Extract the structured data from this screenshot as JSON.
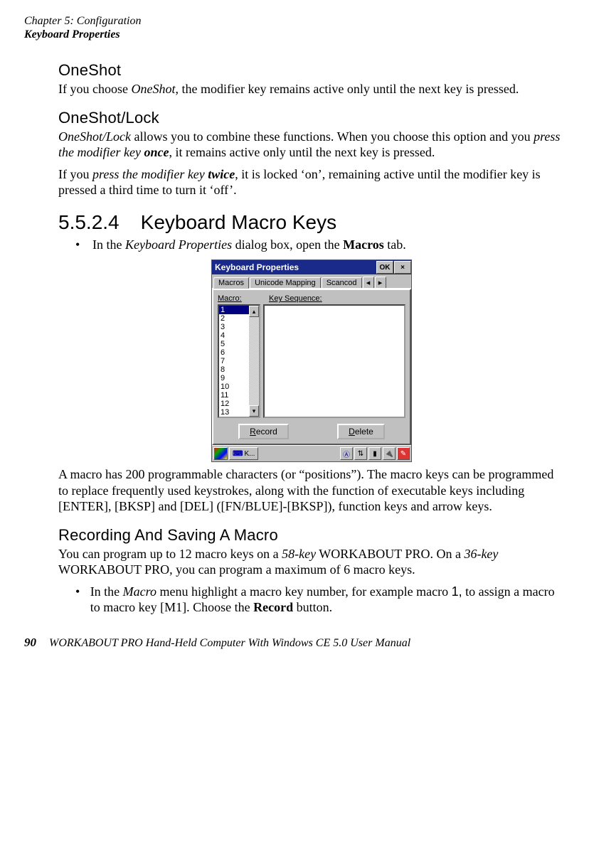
{
  "running_head": {
    "chapter": "Chapter 5: Configuration",
    "section": "Keyboard Properties"
  },
  "h_oneshot": "OneShot",
  "p_oneshot_a": "If you choose ",
  "p_oneshot_i": "OneShot",
  "p_oneshot_b": ", the modifier key remains active only until the next key is pressed.",
  "h_oslock": "OneShot/Lock",
  "p_oslock1_i": "OneShot/Lock",
  "p_oslock1_a": " allows you to combine these functions. When you choose this option and you ",
  "p_oslock1_i2": "press the modifier key ",
  "p_oslock1_bi": "once",
  "p_oslock1_b": ", it remains active only until the next key is pressed.",
  "p_oslock2_a": "If you ",
  "p_oslock2_i": "press the modifier key ",
  "p_oslock2_bi": "twice",
  "p_oslock2_b": ", it is locked ‘on’, remaining active until the modifier key is pressed a third time to turn it ‘off’.",
  "numhead_no": "5.5.2.4",
  "numhead_title": "Keyboard Macro Keys",
  "bullet1_a": "In the ",
  "bullet1_i": "Keyboard Properties",
  "bullet1_b": " dialog box, open the ",
  "bullet1_bold": "Macros",
  "bullet1_c": " tab.",
  "dialog": {
    "title": "Keyboard Properties",
    "ok": "OK",
    "tabs": [
      "Macros",
      "Unicode Mapping",
      "Scancod"
    ],
    "label_macro": "Macro:",
    "label_keyseq": "Key Sequence:",
    "list": [
      "1",
      "2",
      "3",
      "4",
      "5",
      "6",
      "7",
      "8",
      "9",
      "10",
      "11",
      "12",
      "13"
    ],
    "btn_record": "Record",
    "btn_delete": "Delete",
    "taskbar_k": "K..."
  },
  "p_after": "A macro has 200 programmable characters (or “positions”). The macro keys can be programmed to replace frequently used keystrokes, along with the function of executable keys including [ENTER], [BKSP] and [DEL] ([FN/BLUE]-[BKSP]), function keys and arrow keys.",
  "h_rec": "Recording And Saving A Macro",
  "p_rec_a": "You can program up to 12 macro keys on a ",
  "p_rec_i1": "58-key",
  "p_rec_b": " WORKABOUT PRO. On a ",
  "p_rec_i2": "36-key",
  "p_rec_c": " WORKABOUT PRO, you can program a maximum of 6 macro keys.",
  "bullet2_a": "In the ",
  "bullet2_i": "Macro",
  "bullet2_b": " menu highlight a macro key number, for example macro ",
  "bullet2_mono": "1,",
  "bullet2_c": " to assign a macro to macro key [M1]. Choose the ",
  "bullet2_bold": "Record",
  "bullet2_d": " button.",
  "footer": {
    "page": "90",
    "title": "WORKABOUT PRO Hand-Held Computer With Windows CE 5.0 User Manual"
  }
}
